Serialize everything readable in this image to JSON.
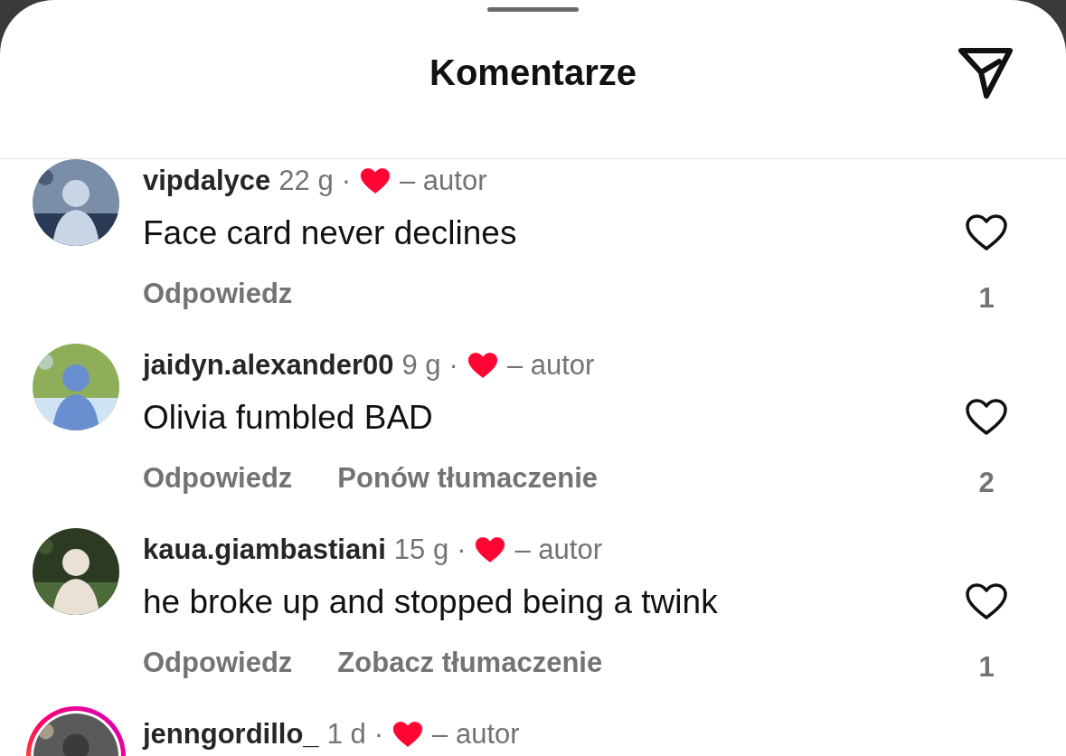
{
  "sheet": {
    "title": "Komentarze"
  },
  "comments": [
    {
      "username": "vipdalyce",
      "time": "22 g",
      "separator": "·",
      "liked_by_author": true,
      "author_label": "– autor",
      "text": "Face card never declines",
      "actions": [
        "Odpowiedz"
      ],
      "likes": "1",
      "has_story": false
    },
    {
      "username": "jaidyn.alexander00",
      "time": "9 g",
      "separator": "·",
      "liked_by_author": true,
      "author_label": "– autor",
      "text": "Olivia fumbled BAD",
      "actions": [
        "Odpowiedz",
        "Ponów tłumaczenie"
      ],
      "likes": "2",
      "has_story": false
    },
    {
      "username": "kaua.giambastiani",
      "time": "15 g",
      "separator": "·",
      "liked_by_author": true,
      "author_label": "– autor",
      "text": "he broke up and stopped being a twink",
      "actions": [
        "Odpowiedz",
        "Zobacz tłumaczenie"
      ],
      "likes": "1",
      "has_story": false
    },
    {
      "username": "jenngordillo_",
      "time": "1 d",
      "separator": "·",
      "liked_by_author": true,
      "author_label": "– autor",
      "has_story": true
    }
  ]
}
